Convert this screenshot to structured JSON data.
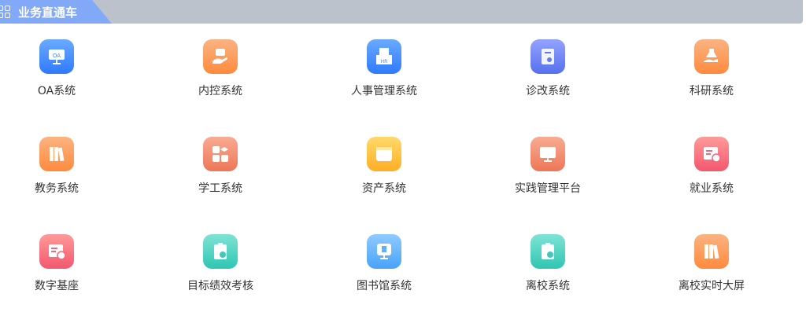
{
  "header": {
    "title": "业务直通车"
  },
  "colors": {
    "blue": "#3d86ff",
    "orange": "#ff914d",
    "teal": "#3ccbb8",
    "red": "#f7667a",
    "coral": "#f18466",
    "yellow": "#ffbb35",
    "indigo": "#6378f2",
    "lightblue": "#5db0fa"
  },
  "items": [
    {
      "label": "OA系统",
      "icon": "oa-monitor-icon",
      "color": "blue"
    },
    {
      "label": "内控系统",
      "icon": "hand-card-icon",
      "color": "orange"
    },
    {
      "label": "人事管理系统",
      "icon": "hr-tray-icon",
      "color": "blue"
    },
    {
      "label": "诊改系统",
      "icon": "clipboard-icon",
      "color": "indigo"
    },
    {
      "label": "科研系统",
      "icon": "flask-hand-icon",
      "color": "orange"
    },
    {
      "label": "教务系统",
      "icon": "books-icon",
      "color": "orange"
    },
    {
      "label": "学工系统",
      "icon": "grad-cap-grid-icon",
      "color": "coral"
    },
    {
      "label": "资产系统",
      "icon": "browser-window-icon",
      "color": "yellow"
    },
    {
      "label": "实践管理平台",
      "icon": "presentation-icon",
      "color": "coral"
    },
    {
      "label": "就业系统",
      "icon": "document-badge-icon",
      "color": "red"
    },
    {
      "label": "数字基座",
      "icon": "document-badge-icon",
      "color": "red"
    },
    {
      "label": "目标绩效考核",
      "icon": "clipboard-clock-icon",
      "color": "teal"
    },
    {
      "label": "图书馆系统",
      "icon": "book-monitor-icon",
      "color": "lightblue"
    },
    {
      "label": "离校系统",
      "icon": "clipboard-clock-icon",
      "color": "teal"
    },
    {
      "label": "离校实时大屏",
      "icon": "books-icon",
      "color": "orange"
    }
  ]
}
